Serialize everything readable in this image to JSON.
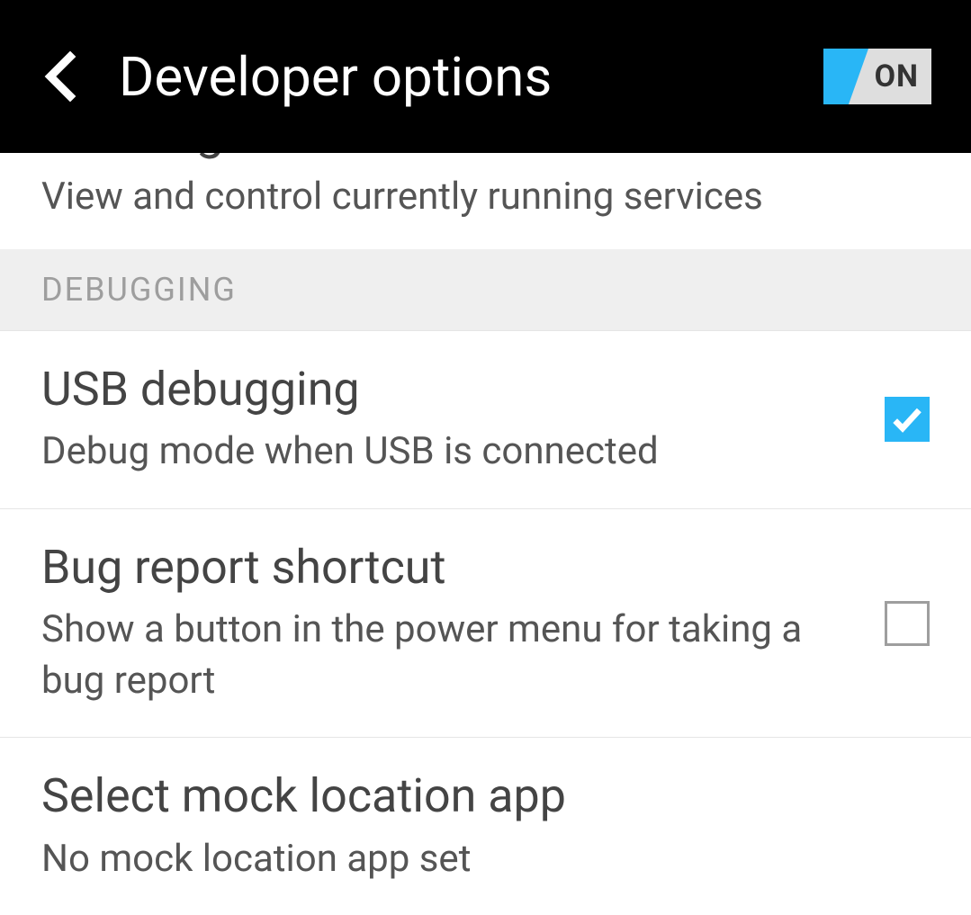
{
  "header": {
    "title": "Developer options",
    "toggle_label": "ON"
  },
  "truncated_item": {
    "title": "Running services",
    "subtitle": "View and control currently running services"
  },
  "section_header": "DEBUGGING",
  "items": [
    {
      "title": "USB debugging",
      "subtitle": "Debug mode when USB is connected",
      "checked": true
    },
    {
      "title": "Bug report shortcut",
      "subtitle": "Show a button in the power menu for taking a bug report",
      "checked": false
    },
    {
      "title": "Select mock location app",
      "subtitle": "No mock location app set",
      "checked": null
    }
  ]
}
